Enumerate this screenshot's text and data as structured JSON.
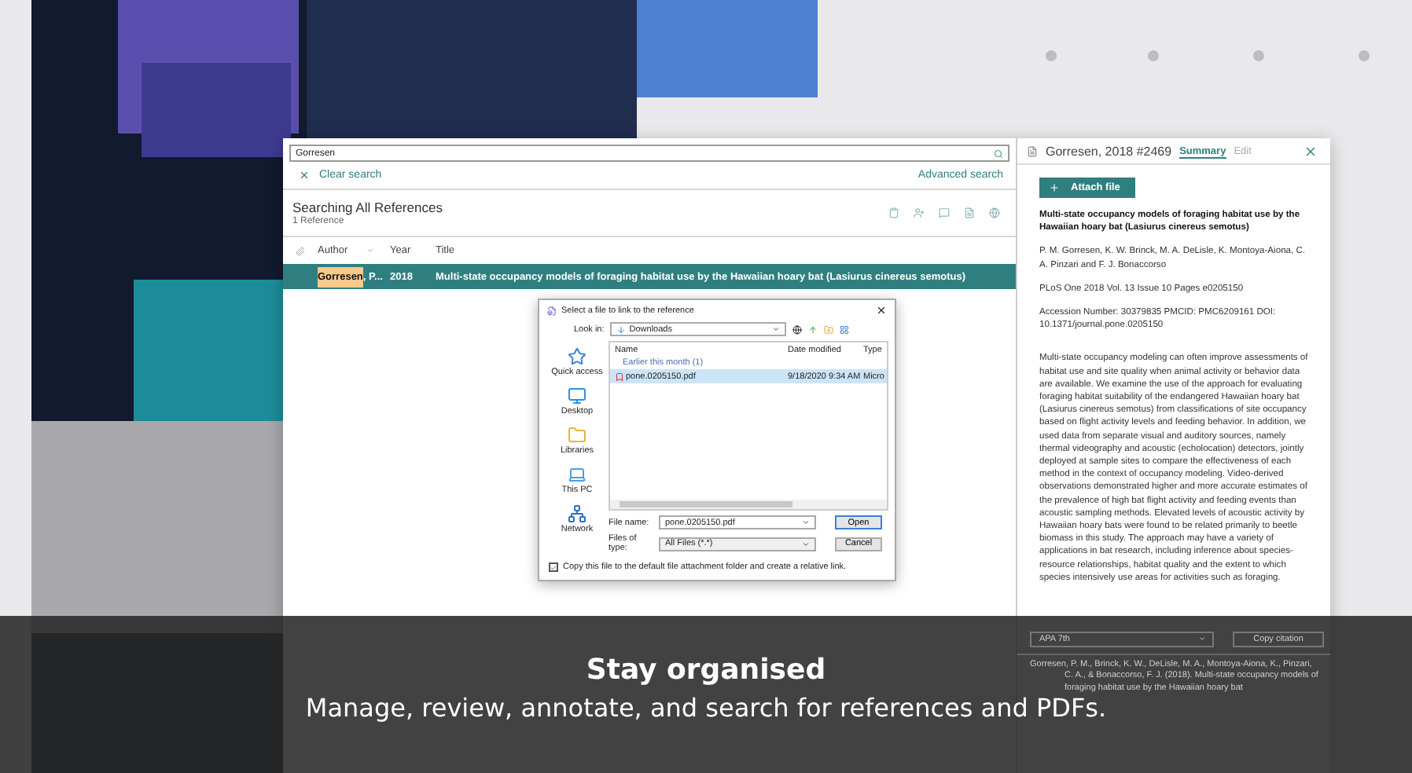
{
  "search": {
    "value": "Gorresen"
  },
  "search_links": {
    "clear": "Clear search",
    "advanced": "Advanced search"
  },
  "results": {
    "title": "Searching All References",
    "count": "1 Reference"
  },
  "table": {
    "columns": [
      "Author",
      "Year",
      "Title"
    ],
    "rows": [
      {
        "author_match": "Gorresen",
        "author_rest": ", P...",
        "year": "2018",
        "title": "Multi-state occupancy models of foraging habitat use by the Hawaiian hoary bat (Lasiurus cinereus semotus)",
        "selected": true
      }
    ]
  },
  "dialog": {
    "title": "Select a file to link to the reference",
    "look_in_label": "Look in:",
    "look_in": "Downloads",
    "places": [
      "Quick access",
      "Desktop",
      "Libraries",
      "This PC",
      "Network"
    ],
    "columns": [
      "Name",
      "Date modified",
      "Type"
    ],
    "group": "Earlier this month (1)",
    "files": [
      {
        "name": "pone.0205150.pdf",
        "date": "9/18/2020 9:34 AM",
        "type": "Micro",
        "selected": true
      }
    ],
    "file_name_label": "File name:",
    "file_name": "pone.0205150.pdf",
    "file_type_label": "Files of type:",
    "file_type": "All Files (*.*)",
    "open": "Open",
    "cancel": "Cancel",
    "copy_option": {
      "label": "Copy this file to the default file attachment folder and create a relative link.",
      "checked": true
    }
  },
  "panel": {
    "title": "Gorresen, 2018 #2469",
    "tabs": [
      {
        "label": "Summary",
        "selected": true
      },
      {
        "label": "Edit",
        "selected": false
      }
    ],
    "attach": "Attach file",
    "ref_title": "Multi-state occupancy models of foraging habitat use by the Hawaiian hoary bat (Lasiurus cinereus semotus)",
    "authors": "P. M. Gorresen, K. W. Brinck, M. A. DeLisle, K. Montoya-Aiona, C. A. Pinzari and F. J. Bonaccorso",
    "source": "PLoS One 2018 Vol. 13 Issue 10 Pages e0205150",
    "accession": "Accession Number: 30379835 PMCID: PMC6209161 DOI: 10.1371/journal.pone.0205150",
    "abstract": "Multi-state occupancy modeling can often improve assessments of habitat use and site quality when animal activity or behavior data are available. We examine the use of the approach for evaluating foraging habitat suitability of the endangered Hawaiian hoary bat (Lasiurus cinereus semotus) from classifications of site occupancy based on flight activity levels and feeding behavior. In addition, we used data from separate visual and auditory sources, namely thermal videography and acoustic (echolocation) detectors, jointly deployed at sample sites to compare the effectiveness of each method in the context of occupancy modeling. Video-derived observations demonstrated higher and more accurate estimates of the prevalence of high bat flight activity and feeding events than acoustic sampling methods. Elevated levels of acoustic activity by Hawaiian hoary bats were found to be related primarily to beetle biomass in this study. The approach may have a variety of applications in bat research, including inference about species-resource relationships, habitat quality and the extent to which species intensively use areas for activities such as foraging.",
    "style": "APA 7th",
    "copy": "Copy citation",
    "citation": "Gorresen, P. M., Brinck, K. W., DeLisle, M. A., Montoya-Aiona, K., Pinzari, C. A., & Bonaccorso, F. J. (2018). Multi-state occupancy models of foraging habitat use by the Hawaiian hoary bat"
  },
  "caption": {
    "title": "Stay organised",
    "text": "Manage, review, annotate, and search for references and PDFs."
  }
}
